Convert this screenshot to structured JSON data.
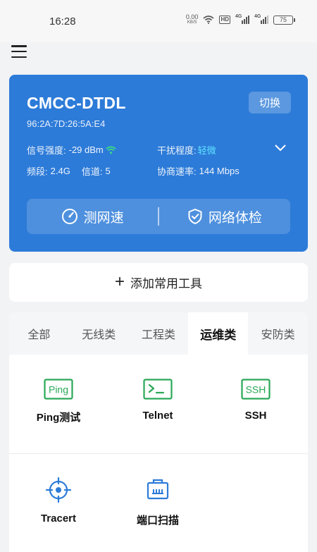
{
  "status_bar": {
    "time": "16:28",
    "net_speed_value": "0.00",
    "net_speed_unit": "KB/S",
    "hd_label": "HD",
    "signal1_label": "4G",
    "signal2_label": "4G",
    "battery": "75"
  },
  "wifi": {
    "ssid": "CMCC-DTDL",
    "mac": "96:2A:7D:26:5A:E4",
    "switch_label": "切换",
    "signal_label": "信号强度:",
    "signal_value": "-29 dBm",
    "interference_label": "干扰程度:",
    "interference_value": "轻微",
    "band_label": "频段:",
    "band_value": "2.4G",
    "channel_label": "信道:",
    "channel_value": "5",
    "rate_label": "协商速率:",
    "rate_value": "144 Mbps",
    "speed_test_label": "测网速",
    "network_check_label": "网络体检",
    "accent_color": "#2d7bd8",
    "highlight_color": "#5fe3ff",
    "signal_icon_color": "#3ddc84"
  },
  "add_tool": {
    "label": "添加常用工具"
  },
  "tabs": [
    {
      "label": "全部"
    },
    {
      "label": "无线类"
    },
    {
      "label": "工程类"
    },
    {
      "label": "运维类",
      "active": true
    },
    {
      "label": "安防类"
    }
  ],
  "tools": [
    {
      "label": "Ping测试",
      "icon": "ping-icon"
    },
    {
      "label": "Telnet",
      "icon": "terminal-icon"
    },
    {
      "label": "SSH",
      "icon": "ssh-icon"
    },
    {
      "label": "Tracert",
      "icon": "crosshair-icon"
    },
    {
      "label": "端口扫描",
      "icon": "port-icon"
    }
  ],
  "icon_text": {
    "ping": "Ping",
    "ssh": "SSH"
  },
  "colors": {
    "green": "#2aa857",
    "blue": "#2d7bd8"
  }
}
